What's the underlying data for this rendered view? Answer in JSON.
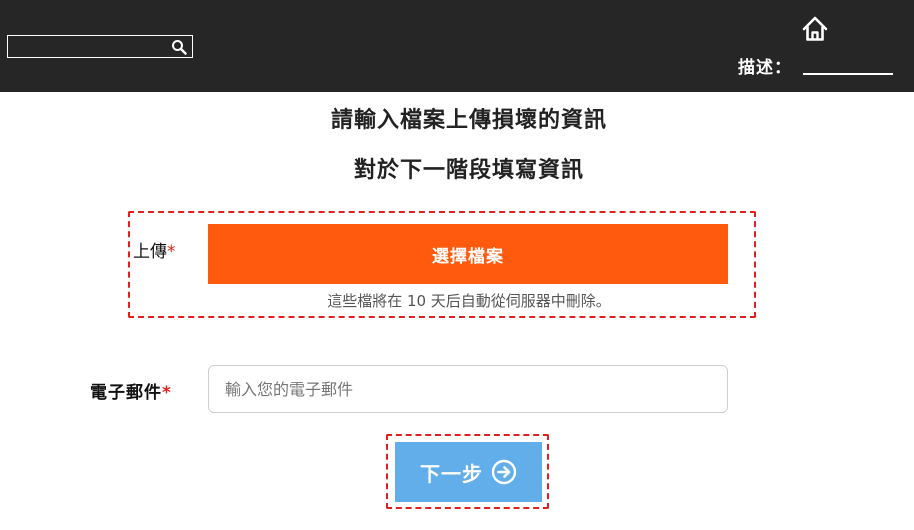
{
  "header": {
    "search": {
      "value": "",
      "placeholder": ""
    },
    "description_label": "描述："
  },
  "main": {
    "heading_line1": "請輸入檔案上傳損壞的資訊",
    "heading_line2": "對於下一階段填寫資訊",
    "upload": {
      "label": "上傳",
      "required_mark": "*",
      "button_label": "選擇檔案",
      "note": "這些檔將在 10 天后自動從伺服器中刪除。"
    },
    "email": {
      "label": "電子郵件",
      "required_mark": "*",
      "value": "",
      "placeholder": "輸入您的電子郵件"
    },
    "next_button_label": "下一步"
  },
  "colors": {
    "topbar": "#262626",
    "upload_button": "#ff5a0e",
    "next_button": "#62aeea",
    "highlight_border": "#e02020"
  },
  "icons": [
    "search-icon",
    "home-icon",
    "arrow-right-circle-icon"
  ]
}
